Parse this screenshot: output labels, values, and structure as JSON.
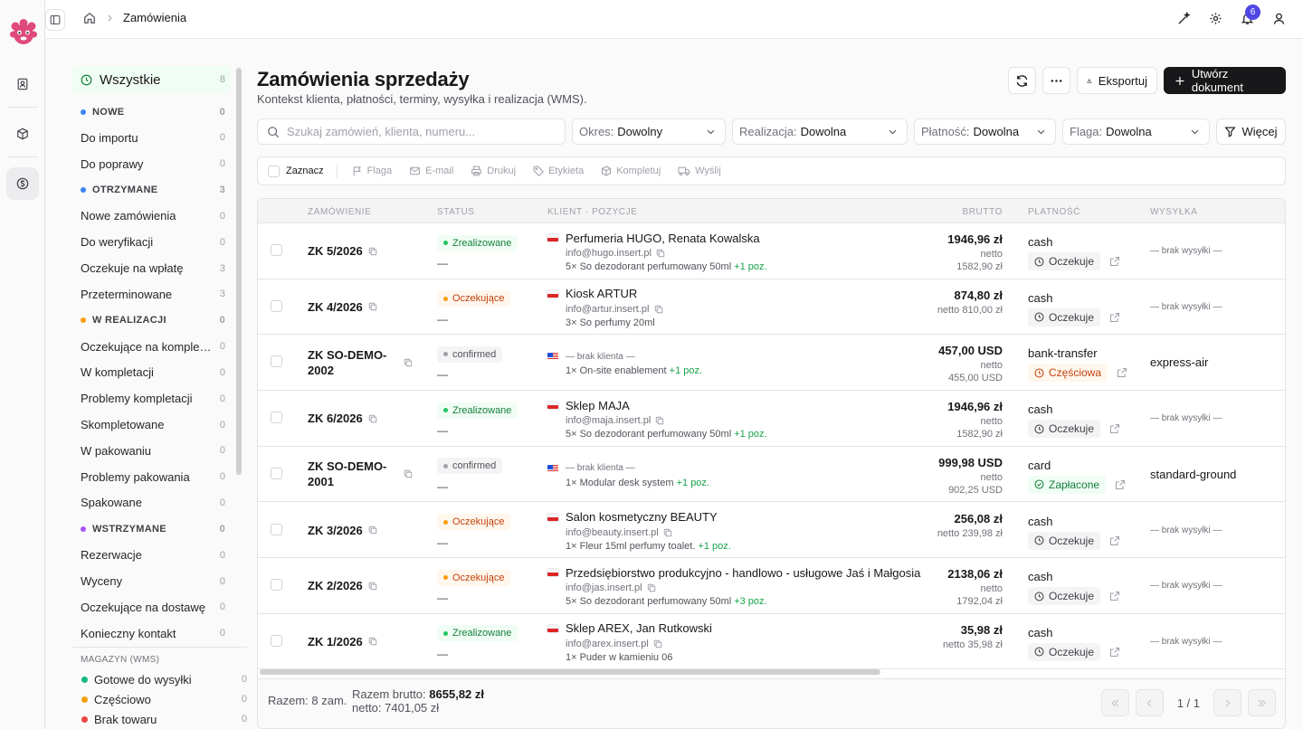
{
  "breadcrumb": {
    "current": "Zamówienia"
  },
  "notifications": {
    "count": "6"
  },
  "page": {
    "title": "Zamówienia sprzedaży",
    "subtitle": "Kontekst klienta, płatności, terminy, wysyłka i realizacja (WMS).",
    "export_label": "Eksportuj",
    "create_label": "Utwórz dokument"
  },
  "sidebar": {
    "all": {
      "label": "Wszystkie",
      "count": "8"
    },
    "groups": [
      {
        "label": "NOWE",
        "color": "#3b82f6",
        "count": "0",
        "items": [
          {
            "label": "Do importu",
            "count": "0"
          },
          {
            "label": "Do poprawy",
            "count": "0"
          }
        ]
      },
      {
        "label": "OTRZYMANE",
        "color": "#3b82f6",
        "count": "3",
        "items": [
          {
            "label": "Nowe zamówienia",
            "count": "0"
          },
          {
            "label": "Do weryfikacji",
            "count": "0"
          },
          {
            "label": "Oczekuje na wpłatę",
            "count": "3"
          },
          {
            "label": "Przeterminowane",
            "count": "3"
          }
        ]
      },
      {
        "label": "W REALIZACJI",
        "color": "#f59e0b",
        "count": "0",
        "items": [
          {
            "label": "Oczekujące na kompletację",
            "count": "0"
          },
          {
            "label": "W kompletacji",
            "count": "0"
          },
          {
            "label": "Problemy kompletacji",
            "count": "0"
          },
          {
            "label": "Skompletowane",
            "count": "0"
          },
          {
            "label": "W pakowaniu",
            "count": "0"
          },
          {
            "label": "Problemy pakowania",
            "count": "0"
          },
          {
            "label": "Spakowane",
            "count": "0"
          }
        ]
      },
      {
        "label": "WSTRZYMANE",
        "color": "#a855f7",
        "count": "0",
        "items": [
          {
            "label": "Rezerwacje",
            "count": "0"
          },
          {
            "label": "Wyceny",
            "count": "0"
          },
          {
            "label": "Oczekujące na dostawę",
            "count": "0"
          },
          {
            "label": "Konieczny kontakt",
            "count": "0"
          }
        ]
      }
    ],
    "wms": {
      "title": "MAGAZYN (WMS)",
      "items": [
        {
          "label": "Gotowe do wysyłki",
          "color": "#10b981",
          "count": "0"
        },
        {
          "label": "Częściowo",
          "color": "#f59e0b",
          "count": "0"
        },
        {
          "label": "Brak towaru",
          "color": "#ef4444",
          "count": "0"
        }
      ]
    }
  },
  "filters": {
    "search_placeholder": "Szukaj zamówień, klienta, numeru...",
    "period": {
      "label": "Okres:",
      "value": "Dowolny"
    },
    "fulfillment": {
      "label": "Realizacja:",
      "value": "Dowolna"
    },
    "payment": {
      "label": "Płatność:",
      "value": "Dowolna"
    },
    "flag": {
      "label": "Flaga:",
      "value": "Dowolna"
    },
    "more_label": "Więcej"
  },
  "bulk": {
    "select_label": "Zaznacz",
    "actions": [
      "Flaga",
      "E-mail",
      "Drukuj",
      "Etykieta",
      "Kompletuj",
      "Wyślij"
    ]
  },
  "table": {
    "headers": {
      "order": "ZAMÓWIENIE",
      "status": "STATUS",
      "client": "KLIENT · POZYCJE",
      "gross": "BRUTTO",
      "payment": "PŁATNOŚĆ",
      "shipping": "WYSYŁKA"
    },
    "rows": [
      {
        "number": "ZK 5/2026",
        "status": "Zrealizowane",
        "status_kind": "ok",
        "flag": "pl",
        "client": "Perfumeria HUGO, Renata Kowalska",
        "email": "info@hugo.insert.pl",
        "items": "5× So dezodorant perfumowany 50ml",
        "more": "+1 poz.",
        "gross": "1946,96 zł",
        "net_label": "netto",
        "net": "1582,90 zł",
        "pay_method": "cash",
        "pay_status": "Oczekuje",
        "pay_kind": "wait",
        "shipping": "— brak wysyłki —"
      },
      {
        "number": "ZK 4/2026",
        "status": "Oczekujące",
        "status_kind": "wait",
        "flag": "pl",
        "client": "Kiosk ARTUR",
        "email": "info@artur.insert.pl",
        "items": "3× So perfumy 20ml",
        "more": "",
        "gross": "874,80 zł",
        "net_label": "netto",
        "net": "810,00 zł",
        "pay_method": "cash",
        "pay_status": "Oczekuje",
        "pay_kind": "wait",
        "shipping": "— brak wysyłki —"
      },
      {
        "number": "ZK SO-DEMO-2002",
        "status": "confirmed",
        "status_kind": "conf",
        "flag": "us",
        "client": "— brak klienta —",
        "email": "",
        "items": "1× On-site enablement",
        "more": "+1 poz.",
        "gross": "457,00 USD",
        "net_label": "netto",
        "net": "455,00 USD",
        "pay_method": "bank-transfer",
        "pay_status": "Częściowa",
        "pay_kind": "part",
        "shipping": "express-air"
      },
      {
        "number": "ZK 6/2026",
        "status": "Zrealizowane",
        "status_kind": "ok",
        "flag": "pl",
        "client": "Sklep MAJA",
        "email": "info@maja.insert.pl",
        "items": "5× So dezodorant perfumowany 50ml",
        "more": "+1 poz.",
        "gross": "1946,96 zł",
        "net_label": "netto",
        "net": "1582,90 zł",
        "pay_method": "cash",
        "pay_status": "Oczekuje",
        "pay_kind": "wait",
        "shipping": "— brak wysyłki —"
      },
      {
        "number": "ZK SO-DEMO-2001",
        "status": "confirmed",
        "status_kind": "conf",
        "flag": "us",
        "client": "— brak klienta —",
        "email": "",
        "items": "1× Modular desk system",
        "more": "+1 poz.",
        "gross": "999,98 USD",
        "net_label": "netto",
        "net": "902,25 USD",
        "pay_method": "card",
        "pay_status": "Zapłacone",
        "pay_kind": "paid",
        "shipping": "standard-ground"
      },
      {
        "number": "ZK 3/2026",
        "status": "Oczekujące",
        "status_kind": "wait",
        "flag": "pl",
        "client": "Salon kosmetyczny BEAUTY",
        "email": "info@beauty.insert.pl",
        "items": "1× Fleur 15ml perfumy toalet.",
        "more": "+1 poz.",
        "gross": "256,08 zł",
        "net_label": "netto",
        "net": "239,98 zł",
        "pay_method": "cash",
        "pay_status": "Oczekuje",
        "pay_kind": "wait",
        "shipping": "— brak wysyłki —"
      },
      {
        "number": "ZK 2/2026",
        "status": "Oczekujące",
        "status_kind": "wait",
        "flag": "pl",
        "client": "Przedsiębiorstwo produkcyjno - handlowo - usługowe Jaś i Małgosia",
        "email": "info@jas.insert.pl",
        "items": "5× So dezodorant perfumowany 50ml",
        "more": "+3 poz.",
        "gross": "2138,06 zł",
        "net_label": "netto",
        "net": "1792,04 zł",
        "pay_method": "cash",
        "pay_status": "Oczekuje",
        "pay_kind": "wait",
        "shipping": "— brak wysyłki —"
      },
      {
        "number": "ZK 1/2026",
        "status": "Zrealizowane",
        "status_kind": "ok",
        "flag": "pl",
        "client": "Sklep AREX, Jan Rutkowski",
        "email": "info@arex.insert.pl",
        "items": "1× Puder w kamieniu 06",
        "more": "",
        "gross": "35,98 zł",
        "net_label": "netto",
        "net": "35,98 zł",
        "pay_method": "cash",
        "pay_status": "Oczekuje",
        "pay_kind": "wait",
        "shipping": "— brak wysyłki —"
      }
    ],
    "row_dash": "—",
    "footer": {
      "count": "Razem: 8 zam.",
      "gross_label": "Razem brutto:",
      "gross_value": "8655,82 zł",
      "net_label": "netto:",
      "net_value": "7401,05 zł",
      "page": "1 / 1"
    }
  }
}
